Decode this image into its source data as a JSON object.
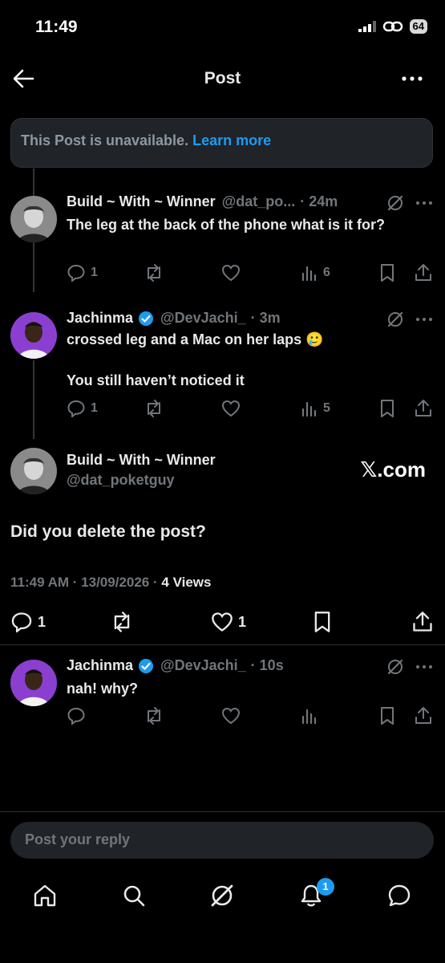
{
  "status_bar": {
    "time": "11:49",
    "battery": "64"
  },
  "header": {
    "title": "Post"
  },
  "unavailable": {
    "text": "This Post is unavailable.",
    "link": "Learn more"
  },
  "thread": [
    {
      "name": "Build ~ With ~ Winner",
      "handle": "@dat_po...",
      "time": "· 24m",
      "text": "The leg at the back of the phone what is it for?",
      "replies": "1",
      "reposts": "",
      "likes": "",
      "views": "6"
    },
    {
      "name": "Jachinma",
      "handle": "@DevJachi_",
      "time": "· 3m",
      "verified": true,
      "text_line1": "crossed leg and a Mac on her laps 🥲",
      "text_line2": "You still haven’t noticed it",
      "replies": "1",
      "reposts": "",
      "likes": "",
      "views": "5"
    }
  ],
  "main_post": {
    "name": "Build ~ With ~ Winner",
    "handle": "@dat_poketguy",
    "watermark": "𝕏.com",
    "text": "Did you delete the post?",
    "meta_time": "11:49 AM · 13/09/2026 ·",
    "views_count": "4",
    "views_label": "Views",
    "replies": "1",
    "likes": "1"
  },
  "reply": {
    "name": "Jachinma",
    "handle": "@DevJachi_",
    "time": "· 10s",
    "text": "nah! why?"
  },
  "composer": {
    "placeholder": "Post your reply"
  },
  "bottom_nav": {
    "notifications_badge": "1"
  },
  "colors": {
    "accent": "#1d9bf0",
    "muted": "#71767b",
    "background": "#000000"
  }
}
